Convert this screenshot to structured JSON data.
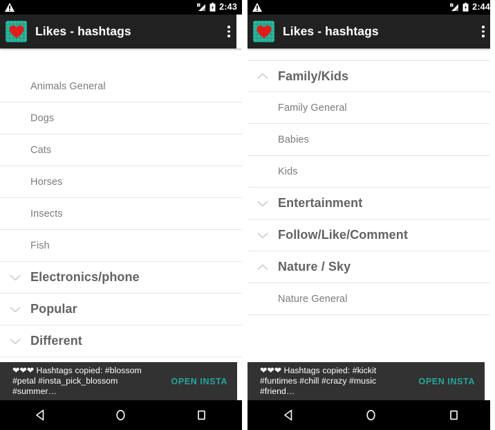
{
  "app": {
    "title": "Likes - hashtags",
    "icon_name": "heart-app-icon",
    "accent_color": "#26a69a",
    "toolbar_color": "#212121",
    "snackbar_color": "#323232"
  },
  "screens": [
    {
      "id": "left",
      "statusbar": {
        "warning_icon": "warning-triangle-icon",
        "signal_icon": "signal-roaming-icon",
        "battery_icon": "battery-charging-icon",
        "time": "2:43"
      },
      "toolbar": {
        "title": "Likes - hashtags",
        "overflow_label": "More options"
      },
      "rows": [
        {
          "type": "child",
          "label": "Animals General"
        },
        {
          "type": "child",
          "label": "Dogs"
        },
        {
          "type": "child",
          "label": "Cats"
        },
        {
          "type": "child",
          "label": "Horses"
        },
        {
          "type": "child",
          "label": "Insects"
        },
        {
          "type": "child",
          "label": "Fish"
        },
        {
          "type": "group",
          "label": "Electronics/phone",
          "expanded": false,
          "chevron": "chevron-down-icon"
        },
        {
          "type": "group",
          "label": "Popular",
          "expanded": false,
          "chevron": "chevron-down-icon"
        },
        {
          "type": "group",
          "label": "Different",
          "expanded": false,
          "chevron": "chevron-down-icon"
        }
      ],
      "snackbar": {
        "hearts": "❤❤❤",
        "message": "❤❤❤ Hashtags copied: #blossom\n#petal #insta_pick_blossom #summer…",
        "action": "OPEN INSTA"
      }
    },
    {
      "id": "right",
      "statusbar": {
        "warning_icon": "warning-triangle-icon",
        "signal_icon": "signal-roaming-icon",
        "battery_icon": "battery-charging-icon",
        "time": "2:44"
      },
      "toolbar": {
        "title": "Likes - hashtags",
        "overflow_label": "More options"
      },
      "rows": [
        {
          "type": "group",
          "label": "Family/Kids",
          "expanded": true,
          "chevron": "chevron-up-icon"
        },
        {
          "type": "child",
          "label": "Family General"
        },
        {
          "type": "child",
          "label": "Babies"
        },
        {
          "type": "child",
          "label": "Kids"
        },
        {
          "type": "group",
          "label": "Entertainment",
          "expanded": false,
          "chevron": "chevron-down-icon"
        },
        {
          "type": "group",
          "label": "Follow/Like/Comment",
          "expanded": false,
          "chevron": "chevron-down-icon"
        },
        {
          "type": "group",
          "label": "Nature / Sky",
          "expanded": true,
          "chevron": "chevron-up-icon"
        },
        {
          "type": "child",
          "label": "Nature General"
        }
      ],
      "snackbar": {
        "hearts": "❤❤❤",
        "message": "❤❤❤ Hashtags copied: #kickit\n#funtimes #chill #crazy #music #friend…",
        "action": "OPEN INSTA"
      }
    }
  ],
  "navbar": {
    "back_label": "Back",
    "home_label": "Home",
    "recents_label": "Recents",
    "back_icon": "triangle-back-icon",
    "home_icon": "circle-home-icon",
    "recents_icon": "square-recents-icon"
  }
}
